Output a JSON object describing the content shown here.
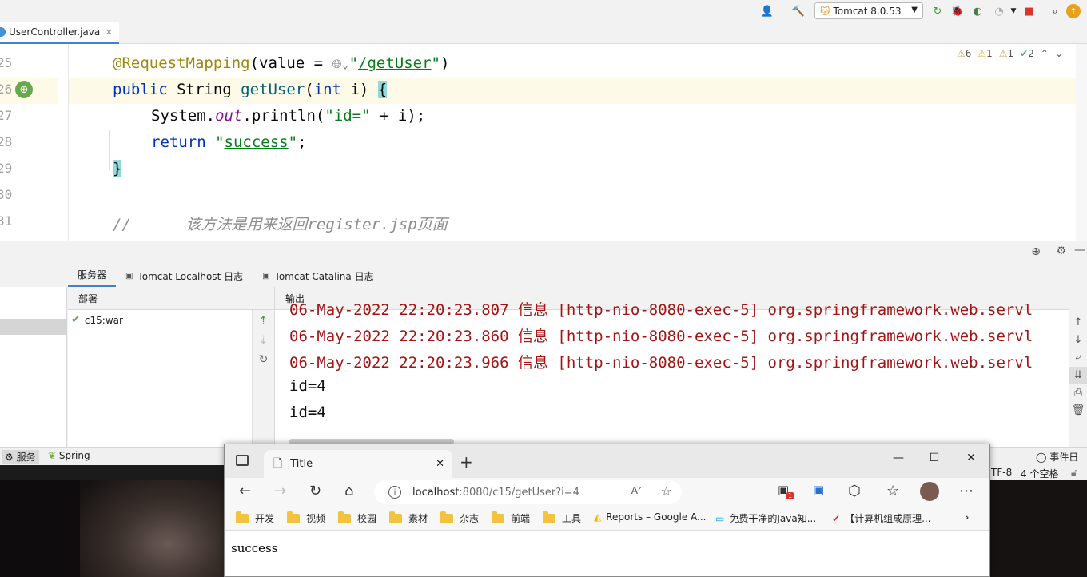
{
  "toolbar": {
    "run_config": "Tomcat 8.0.53"
  },
  "editor": {
    "tab_label": "UserController.java",
    "line_numbers": [
      "25",
      "26",
      "27",
      "28",
      "29",
      "30",
      "31"
    ],
    "lines": {
      "l1_ann": "@RequestMapping",
      "l1_open": "(value = ",
      "l1_str_q1": "\"",
      "l1_str_val": "/getUser",
      "l1_str_q2": "\"",
      "l1_close": ")",
      "l2_public": "public",
      "l2_type": " String ",
      "l2_fn": "getUser",
      "l2_paren": "(",
      "l2_int": "int",
      "l2_rest": " i) ",
      "l2_brace": "{",
      "l3_sys": "System.",
      "l3_out": "out",
      "l3_print": ".println(",
      "l3_str": "\"id=\"",
      "l3_rest": " + i);",
      "l4_return": "return",
      "l4_q1": " \"",
      "l4_val": "success",
      "l4_q2": "\"",
      "l4_semi": ";",
      "l5_brace": "}",
      "l7_comment": "//      该方法是用来返回register.jsp页面"
    },
    "inspections": {
      "warnings": "6",
      "weak_warnings": "1",
      "typos": "1",
      "ok": "2"
    }
  },
  "services": {
    "tabs": [
      "服务器",
      "Tomcat Localhost 日志",
      "Tomcat Catalina 日志"
    ],
    "deploy_header": "部署",
    "deploy_item": "c15:war",
    "output_header": "输出",
    "log_lines": [
      "06-May-2022 22:20:23.807 信息 [http-nio-8080-exec-5] org.springframework.web.servl",
      "06-May-2022 22:20:23.860 信息 [http-nio-8080-exec-5] org.springframework.web.servl",
      "06-May-2022 22:20:23.966 信息 [http-nio-8080-exec-5] org.springframework.web.servl",
      "id=4",
      "id=4"
    ]
  },
  "bottom_tabs": {
    "services": "服务",
    "spring": "Spring",
    "event_log": "事件日志"
  },
  "status": {
    "encoding": "TF-8",
    "indent": "4 个空格"
  },
  "browser": {
    "tab_title": "Title",
    "url_host": "localhost",
    "url_path": ":8080/c15/getUser?i=4",
    "extension_badge": "1",
    "bookmarks": [
      "开发",
      "视频",
      "校园",
      "素材",
      "杂志",
      "前端",
      "工具",
      "Reports – Google A...",
      "免费干净的Java知...",
      "【计算机组成原理..."
    ],
    "page_content": "success"
  },
  "colors": {
    "keyword": "#0033b3",
    "annotation": "#9e880d",
    "string": "#067d17",
    "log_red": "#a31515",
    "accent": "#4083c9"
  }
}
